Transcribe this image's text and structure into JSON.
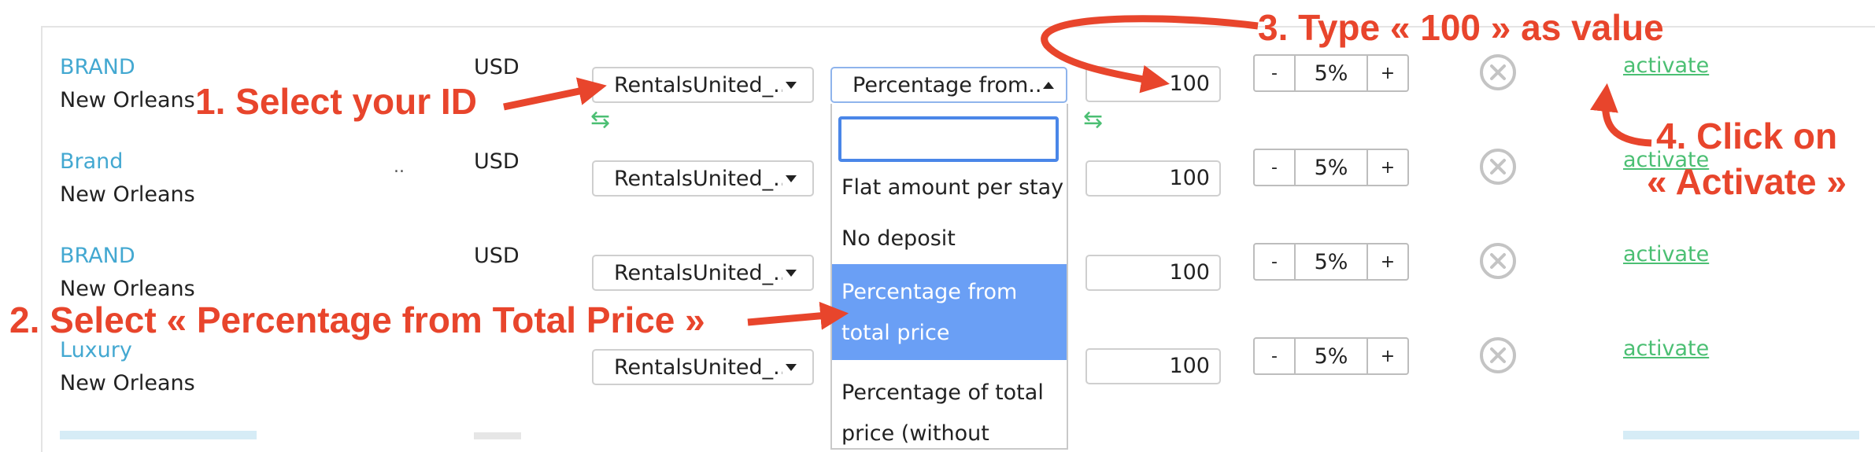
{
  "rows": [
    {
      "brand": "BRAND",
      "city": "New Orleans",
      "currency": "USD",
      "source": "RentalsUnited_...",
      "deposit": "Percentage from...",
      "value": "100",
      "discount": "5%",
      "action": "activate"
    },
    {
      "brand": "Brand",
      "city": "New Orleans",
      "currency": "USD",
      "source": "RentalsUnited_...",
      "value": "100",
      "discount": "5%",
      "action": "activate",
      "dots": ".."
    },
    {
      "brand": "BRAND",
      "city": "New Orleans",
      "currency": "USD",
      "source": "RentalsUnited_...",
      "value": "100",
      "discount": "5%",
      "action": "activate"
    },
    {
      "brand": "Luxury",
      "city": "New Orleans",
      "source": "RentalsUnited_...",
      "value": "100",
      "discount": "5%",
      "action": "activate"
    }
  ],
  "stepper": {
    "minus": "-",
    "plus": "+"
  },
  "dropdown": {
    "search_value": "",
    "options": [
      "Flat amount per stay",
      "No deposit",
      "Percentage from",
      "total price",
      "Percentage of total",
      "price (without"
    ]
  },
  "annotations": {
    "step1": "1. Select your ID",
    "step2": "2. Select « Percentage from Total Price »",
    "step3": "3. Type « 100 » as value",
    "step4_line1": "4. Click on",
    "step4_line2": "« Activate »"
  },
  "colors": {
    "brand": "#43a8d1",
    "activate": "#4bbf73",
    "annotation": "#e8452c",
    "selected_option": "#6a9ff5"
  }
}
